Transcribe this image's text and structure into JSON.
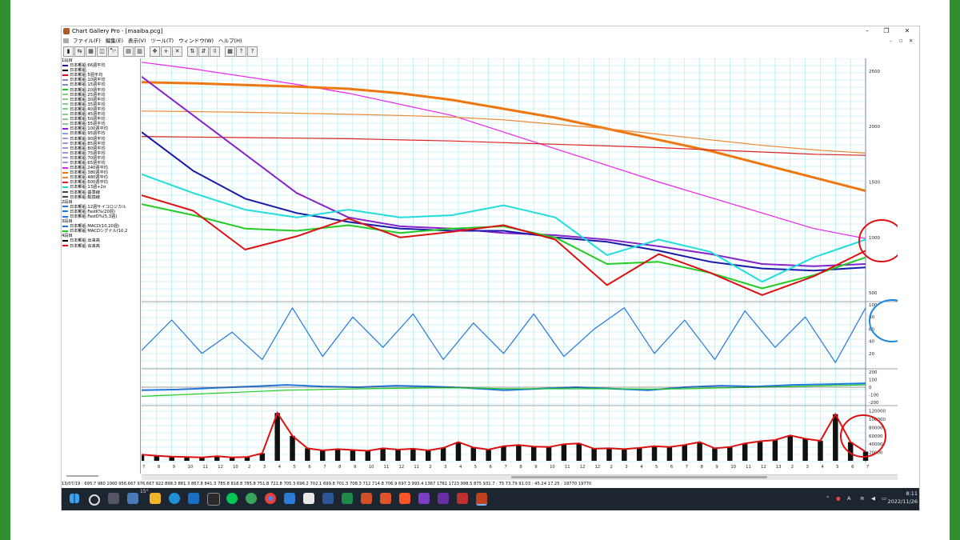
{
  "window": {
    "title": "Chart Gallery Pro - [maaiba.pcg]",
    "minimize": "–",
    "maximize": "❐",
    "close": "✕",
    "mdi_controls": [
      "–",
      "▫",
      "✕"
    ]
  },
  "menu": [
    "ファイル(F)",
    "編集(E)",
    "表示(V)",
    "ツール(T)",
    "ウィンドウ(W)",
    "ヘルプ(H)"
  ],
  "toolbar": [
    "▮",
    "⇆",
    "▦",
    "◫",
    "🔭",
    "▤",
    "▥",
    "✥",
    "+",
    "✕",
    "⇅",
    "⇵",
    "⇳",
    "▩",
    "?",
    "?"
  ],
  "legend": [
    {
      "section": "1段目"
    },
    {
      "label": "日本郵船 66週平均",
      "color": "#1a1aaa"
    },
    {
      "label": "日本郵船",
      "color": "#000000"
    },
    {
      "label": "日本郵船 5週平均",
      "color": "#dd1111"
    },
    {
      "label": "日本郵船 10週平均",
      "color": "#8888cc"
    },
    {
      "label": "日本郵船 15週平均",
      "color": "#8888cc"
    },
    {
      "label": "日本郵船 20週平均",
      "color": "#22cc22"
    },
    {
      "label": "日本郵船 25週平均",
      "color": "#88cc88"
    },
    {
      "label": "日本郵船 30週平均",
      "color": "#88cc88"
    },
    {
      "label": "日本郵船 35週平均",
      "color": "#88cc88"
    },
    {
      "label": "日本郵船 40週平均",
      "color": "#88cc88"
    },
    {
      "label": "日本郵船 45週平均",
      "color": "#88cc88"
    },
    {
      "label": "日本郵船 50週平均",
      "color": "#88cc88"
    },
    {
      "label": "日本郵船 55週平均",
      "color": "#88cc88"
    },
    {
      "label": "日本郵船 100週平均",
      "color": "#8822cc"
    },
    {
      "label": "日本郵船 95週平均",
      "color": "#9999dd"
    },
    {
      "label": "日本郵船 90週平均",
      "color": "#9999dd"
    },
    {
      "label": "日本郵船 85週平均",
      "color": "#9999dd"
    },
    {
      "label": "日本郵船 80週平均",
      "color": "#9999dd"
    },
    {
      "label": "日本郵船 75週平均",
      "color": "#9999dd"
    },
    {
      "label": "日本郵船 70週平均",
      "color": "#9999dd"
    },
    {
      "label": "日本郵船 65週平均",
      "color": "#9999dd"
    },
    {
      "label": "日本郵船 240週平均",
      "color": "#ee22ee"
    },
    {
      "label": "日本郵船 380週平均",
      "color": "#ee7711"
    },
    {
      "label": "日本郵船 480週平均",
      "color": "#ee8833"
    },
    {
      "label": "日本郵船 600週平均",
      "color": "#dd2222"
    },
    {
      "label": "日本郵船 13週+2σ",
      "color": "#22dddd"
    },
    {
      "label": "日本郵船 基準線",
      "color": "#444444"
    },
    {
      "label": "日本郵船 転換線",
      "color": "#444444"
    },
    {
      "section": "2段目"
    },
    {
      "label": "日本郵船 12週サイコロジカル",
      "color": "#2277dd"
    },
    {
      "label": "日本郵船 FastK%(20週)",
      "color": "#2277dd"
    },
    {
      "label": "日本郵船 FastD%(5,3週)",
      "color": "#2277dd"
    },
    {
      "section": "3段目"
    },
    {
      "label": "日本郵船 MACD(10,20週)",
      "color": "#2277dd"
    },
    {
      "label": "日本郵船 MACDシグナル(10,2",
      "color": "#22cc22"
    },
    {
      "section": "4段目"
    },
    {
      "label": "日本郵船 出来高",
      "color": "#000000"
    },
    {
      "label": "日本郵船 出来高",
      "color": "#dd1111"
    }
  ],
  "axes": {
    "price_ticks": [
      "2500",
      "2000",
      "1500",
      "1000",
      "500"
    ],
    "psy_ticks": [
      "100",
      "80",
      "60",
      "40",
      "20"
    ],
    "macd_ticks": [
      "200",
      "100",
      "0",
      "-100",
      "-200"
    ],
    "volume_ticks": [
      "120000",
      "100000",
      "80000",
      "60000",
      "40000",
      "20000"
    ],
    "x_labels": [
      "7",
      "8",
      "9",
      "10",
      "11",
      "12",
      "10",
      "2",
      "3",
      "4",
      "5",
      "6",
      "7",
      "8",
      "9",
      "10",
      "11",
      "12",
      "11",
      "2",
      "3",
      "4",
      "5",
      "6",
      "7",
      "8",
      "9",
      "10",
      "11",
      "12",
      "12",
      "2",
      "3",
      "4",
      "5",
      "6",
      "7",
      "8",
      "9",
      "10",
      "11",
      "12",
      "13",
      "2",
      "3",
      "4",
      "5",
      "6",
      "7"
    ]
  },
  "status_bar": "13/07/19 : 695.7 980 1000 956.667 976.667 922 898.3 881.3 867.8 841.3 785.8 818.8 785.8 751.8 722.8 705.3 696.2 702.1 699.8 701.3 708.3 712 714.8 706.9 697.3 993.4 1367 1761 1723 998.5 875 931.7 : 75 73.79 91.03 : 45.24 17.25 : 19770 19770",
  "taskbar": {
    "weather": "15°",
    "time": "8:11",
    "date": "2022/11/26",
    "ime": "A"
  },
  "chart_data": [
    {
      "type": "line",
      "panel": "price",
      "ylim": [
        450,
        2600
      ],
      "series_count_note": "",
      "series": [
        {
          "name": "日本郵船 240週平均",
          "color": "#ee22ee",
          "values": [
            2580,
            2520,
            2450,
            2380,
            2300,
            2200,
            2100,
            1950,
            1800,
            1650,
            1500,
            1360,
            1220,
            1080,
            990
          ]
        },
        {
          "name": "日本郵船 380週平均",
          "color": "#ee7711",
          "values": [
            2400,
            2390,
            2375,
            2360,
            2340,
            2300,
            2240,
            2160,
            2080,
            1980,
            1880,
            1780,
            1660,
            1540,
            1420
          ]
        },
        {
          "name": "日本郵船 480週平均",
          "color": "#ee8833",
          "values": [
            2140,
            2135,
            2128,
            2120,
            2110,
            2100,
            2085,
            2060,
            2020,
            1980,
            1930,
            1880,
            1830,
            1790,
            1760
          ]
        },
        {
          "name": "日本郵船 600週平均",
          "color": "#dd2222",
          "values": [
            1910,
            1905,
            1900,
            1895,
            1890,
            1880,
            1870,
            1855,
            1840,
            1825,
            1810,
            1790,
            1770,
            1750,
            1740
          ]
        },
        {
          "name": "日本郵船 100週平均",
          "color": "#8822cc",
          "values": [
            2450,
            2100,
            1750,
            1400,
            1180,
            1100,
            1080,
            1040,
            1020,
            980,
            920,
            850,
            760,
            740,
            760
          ]
        },
        {
          "name": "日本郵船 66週平均",
          "color": "#1a1aaa",
          "values": [
            1950,
            1600,
            1350,
            1220,
            1140,
            1080,
            1060,
            1060,
            1000,
            960,
            880,
            780,
            720,
            700,
            730
          ]
        },
        {
          "name": "日本郵船 13週+2σ",
          "color": "#22dddd",
          "values": [
            1570,
            1400,
            1250,
            1180,
            1250,
            1180,
            1200,
            1290,
            1180,
            840,
            980,
            870,
            600,
            820,
            980
          ]
        },
        {
          "name": "日本郵船 20週平均",
          "color": "#22cc22",
          "values": [
            1300,
            1200,
            1080,
            1060,
            1110,
            1040,
            1080,
            1100,
            1000,
            760,
            780,
            680,
            540,
            660,
            820
          ]
        },
        {
          "name": "日本郵船 5週平均",
          "color": "#dd1111",
          "values": [
            1380,
            1240,
            890,
            1010,
            1170,
            1000,
            1050,
            1110,
            980,
            570,
            850,
            680,
            480,
            650,
            880
          ]
        }
      ]
    },
    {
      "type": "line",
      "panel": "psychological",
      "ylim": [
        0,
        100
      ],
      "series": [
        {
          "name": "日本郵船 12週サイコロジカル",
          "color": "#2277dd",
          "values": [
            25,
            75,
            20,
            55,
            10,
            95,
            15,
            80,
            30,
            85,
            10,
            70,
            20,
            85,
            15,
            60,
            95,
            20,
            75,
            10,
            90,
            30,
            80,
            5,
            95
          ]
        }
      ]
    },
    {
      "type": "line",
      "panel": "macd",
      "ylim": [
        -200,
        200
      ],
      "series": [
        {
          "name": "日本郵船 MACD(10,20週)",
          "color": "#2277dd",
          "values": [
            -40,
            -30,
            -10,
            10,
            30,
            10,
            0,
            20,
            10,
            -10,
            -40,
            -20,
            0,
            -20,
            -40,
            0,
            20,
            10,
            30,
            40,
            50
          ]
        },
        {
          "name": "日本郵船 MACDシグナル(10,2",
          "color": "#22cc22",
          "values": [
            -120,
            -100,
            -80,
            -60,
            -40,
            -30,
            -20,
            -15,
            -10,
            -10,
            -20,
            -20,
            -20,
            -20,
            -25,
            -20,
            -10,
            0,
            10,
            20,
            30
          ]
        }
      ]
    },
    {
      "type": "bar",
      "panel": "volume",
      "ylim": [
        0,
        125000
      ],
      "series": [
        {
          "name": "日本郵船 出来高",
          "color": "#dd1111",
          "values": [
            15000,
            12000,
            10000,
            9000,
            8000,
            11000,
            8000,
            9000,
            18000,
            115000,
            60000,
            30000,
            25000,
            28000,
            26000,
            24000,
            30000,
            27000,
            29000,
            25000,
            31000,
            45000,
            32000,
            27000,
            35000,
            38000,
            34000,
            33000,
            40000,
            42000,
            29000,
            30000,
            28000,
            31000,
            35000,
            33000,
            38000,
            45000,
            30000,
            33000,
            42000,
            47000,
            50000,
            61000,
            53000,
            48000,
            112000,
            45000,
            22000
          ]
        }
      ]
    }
  ]
}
